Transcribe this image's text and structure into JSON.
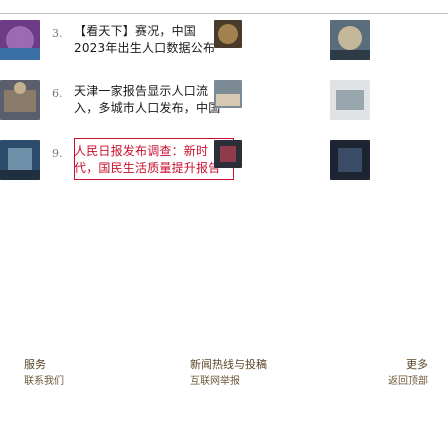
{
  "news": {
    "items": [
      {
        "num": "3.",
        "title": "【看天下】赛况，中国2023年出生人口数据公布",
        "thumb": "thumb-a"
      },
      {
        "num": "6.",
        "title": "天津一家报告显示人口流入，多城市人口发布，中国",
        "thumb": "thumb-b"
      },
      {
        "num": "9.",
        "title": "人民日报发布调查：新时代，国民生活质量提升报告",
        "thumb": "thumb-c",
        "focused": true
      }
    ]
  },
  "footer": {
    "left": {
      "title": "服务",
      "sub": "联系我们"
    },
    "center": {
      "title": "新闻热线与投稿",
      "sub": "互联网举报"
    },
    "right": {
      "title": "更多",
      "sub": "返回顶部"
    }
  },
  "colors": {
    "accent": "#c8102e",
    "rule": "#bfbfbf",
    "footer_text": "#6d5a3a"
  }
}
